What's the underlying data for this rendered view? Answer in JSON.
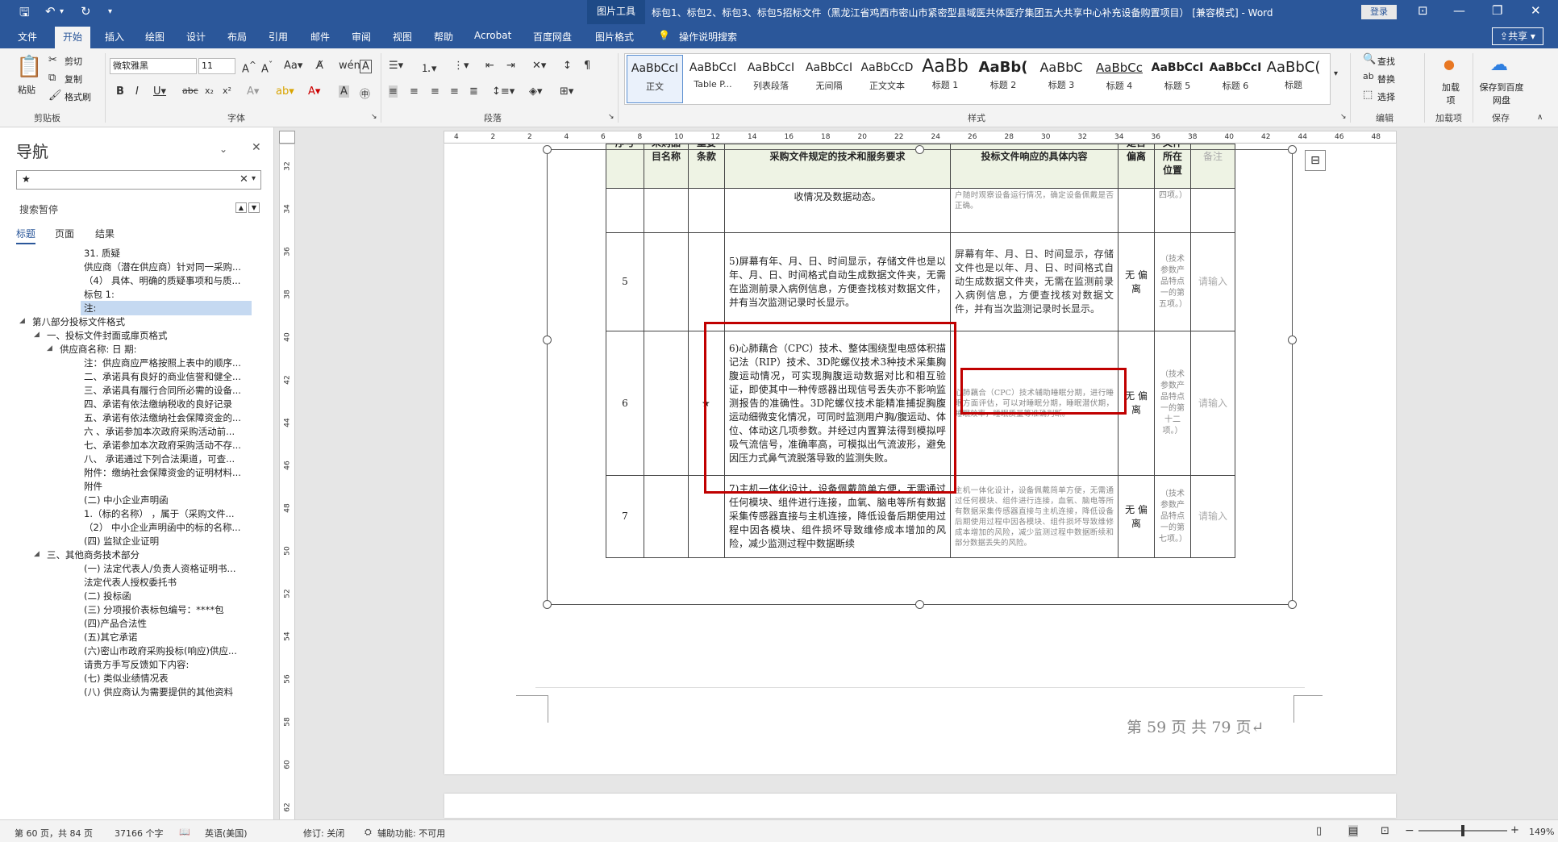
{
  "titlebar": {
    "context_tab": "图片工具",
    "doc_title": "标包1、标包2、标包3、标包5招标文件（黑龙江省鸡西市密山市紧密型县域医共体医疗集团五大共享中心补充设备购置项目） [兼容模式] - Word",
    "login": "登录"
  },
  "tabs": {
    "items": [
      "文件",
      "开始",
      "插入",
      "绘图",
      "设计",
      "布局",
      "引用",
      "邮件",
      "审阅",
      "视图",
      "帮助",
      "Acrobat",
      "百度网盘",
      "图片格式"
    ],
    "tell_me": "操作说明搜索",
    "share": "共享"
  },
  "ribbon": {
    "clipboard": {
      "paste": "粘贴",
      "cut": "剪切",
      "copy": "复制",
      "format_painter": "格式刷",
      "label": "剪贴板"
    },
    "font": {
      "name": "微软雅黑",
      "size": "11",
      "label": "字体"
    },
    "paragraph": {
      "label": "段落"
    },
    "styles": {
      "label": "样式",
      "items": [
        {
          "sample": "AaBbCcI",
          "name": "正文"
        },
        {
          "sample": "AaBbCcI",
          "name": "Table P..."
        },
        {
          "sample": "AaBbCcI",
          "name": "列表段落"
        },
        {
          "sample": "AaBbCcI",
          "name": "无间隔"
        },
        {
          "sample": "AaBbCcD",
          "name": "正文文本"
        },
        {
          "sample": "AaBb",
          "name": "标题 1"
        },
        {
          "sample": "AaBb(",
          "name": "标题 2"
        },
        {
          "sample": "AaBbC",
          "name": "标题 3"
        },
        {
          "sample": "AaBbCc",
          "name": "标题 4"
        },
        {
          "sample": "AaBbCcI",
          "name": "标题 5"
        },
        {
          "sample": "AaBbCcI",
          "name": "标题 6"
        },
        {
          "sample": "AaBbC(",
          "name": "标题"
        }
      ]
    },
    "editing": {
      "find": "查找",
      "replace": "替换",
      "select": "选择",
      "label": "编辑"
    },
    "addins": {
      "load": "加载项",
      "label": "加载项"
    },
    "save": {
      "baidu": "保存到百度网盘",
      "label": "保存"
    }
  },
  "nav": {
    "title": "导航",
    "search_value": "★",
    "search_status": "搜索暂停",
    "tabs": [
      "标题",
      "页面",
      "结果"
    ],
    "items": [
      {
        "text": "31. 质疑",
        "level": 3,
        "tri": ""
      },
      {
        "text": "供应商（潜在供应商）针对同一采购...",
        "level": 3,
        "tri": ""
      },
      {
        "text": "（4） 具体、明确的质疑事项和与质...",
        "level": 3,
        "tri": ""
      },
      {
        "text": "标包 1:",
        "level": 3,
        "tri": ""
      },
      {
        "text": "注:",
        "level": 3,
        "tri": "",
        "highlight": true
      },
      {
        "text": "第八部分投标文件格式",
        "level": 1,
        "tri": "◢"
      },
      {
        "text": "一、投标文件封面或扉页格式",
        "level": 2,
        "tri": "◢"
      },
      {
        "text": "供应商名称:                    日 期:",
        "level": 3,
        "tri": "◢",
        "indent": 60
      },
      {
        "text": "注：供应商应严格按照上表中的顺序...",
        "level": 3,
        "tri": ""
      },
      {
        "text": "二、承诺具有良好的商业信誉和健全...",
        "level": 3,
        "tri": ""
      },
      {
        "text": "三、承诺具有履行合同所必需的设备...",
        "level": 3,
        "tri": ""
      },
      {
        "text": "四、承诺有依法缴纳税收的良好记录",
        "level": 3,
        "tri": ""
      },
      {
        "text": "五、承诺有依法缴纳社会保障资金的...",
        "level": 3,
        "tri": ""
      },
      {
        "text": "六 、承诺参加本次政府采购活动前...",
        "level": 3,
        "tri": ""
      },
      {
        "text": "七、承诺参加本次政府采购活动不存...",
        "level": 3,
        "tri": ""
      },
      {
        "text": "八、 承诺通过下列合法渠道，可查...",
        "level": 3,
        "tri": ""
      },
      {
        "text": "附件：缴纳社会保障资金的证明材料...",
        "level": 3,
        "tri": ""
      },
      {
        "text": "附件",
        "level": 3,
        "tri": ""
      },
      {
        "text": "(二) 中小企业声明函",
        "level": 3,
        "tri": ""
      },
      {
        "text": "1.（标的名称）   ，属于（采购文件...",
        "level": 3,
        "tri": ""
      },
      {
        "text": "（2） 中小企业声明函中的标的名称...",
        "level": 3,
        "tri": ""
      },
      {
        "text": "(四) 监狱企业证明",
        "level": 3,
        "tri": ""
      },
      {
        "text": "三、其他商务技术部分",
        "level": 2,
        "tri": "◢"
      },
      {
        "text": "(一) 法定代表人/负责人资格证明书...",
        "level": 3,
        "tri": ""
      },
      {
        "text": "法定代表人授权委托书",
        "level": 3,
        "tri": ""
      },
      {
        "text": "(二) 投标函",
        "level": 3,
        "tri": ""
      },
      {
        "text": "(三) 分项报价表标包编号：****包",
        "level": 3,
        "tri": ""
      },
      {
        "text": "(四)产品合法性",
        "level": 3,
        "tri": ""
      },
      {
        "text": "(五)其它承诺",
        "level": 3,
        "tri": ""
      },
      {
        "text": "(六)密山市政府采购投标(响应)供应...",
        "level": 3,
        "tri": ""
      },
      {
        "text": "请贵方手写反馈如下内容:",
        "level": 3,
        "tri": ""
      },
      {
        "text": "(七) 类似业绩情况表",
        "level": 3,
        "tri": ""
      },
      {
        "text": "(八) 供应商认为需要提供的其他资料",
        "level": 3,
        "tri": ""
      }
    ]
  },
  "ruler": {
    "h_ticks": [
      "4",
      "2",
      "2",
      "4",
      "6",
      "8",
      "10",
      "12",
      "14",
      "16",
      "18",
      "20",
      "22",
      "24",
      "26",
      "28",
      "30",
      "32",
      "34",
      "36",
      "38",
      "40",
      "42",
      "44",
      "46",
      "48"
    ],
    "v_ticks": [
      "32",
      "34",
      "36",
      "38",
      "40",
      "42",
      "44",
      "46",
      "48",
      "50",
      "52",
      "54",
      "56",
      "58",
      "60",
      "62"
    ]
  },
  "table": {
    "headers": [
      "序号",
      "采购品目名称",
      "重要条款",
      "采购文件规定的技术和服务要求",
      "投标文件响应的具体内容",
      "是否偏离",
      "文件所在位置",
      "备注"
    ],
    "rows": [
      {
        "no": "",
        "req": "收情况及数据动态。",
        "resp": "户随时观察设备运行情况，确定设备佩戴是否正确。",
        "dev": "",
        "loc": "四项。）",
        "note": "",
        "small": true
      },
      {
        "no": "5",
        "req": "5)屏幕有年、月、日、时间显示，存储文件也是以年、月、日、时间格式自动生成数据文件夹，无需在监测前录入病例信息，方便查找核对数据文件，并有当次监测记录时长显示。",
        "resp": "屏幕有年、月、日、时间显示，存储文件也是以年、月、日、时间格式自动生成数据文件夹，无需在监测前录入病例信息，方便查找核对数据文件，并有当次监测记录时长显示。",
        "dev": "无 偏离",
        "loc": "（技术参数产品特点一的第五项。）",
        "note": "请输入",
        "small": false
      },
      {
        "no": "6",
        "req": "6)心肺藕合（CPC）技术、整体围绕型电感体积描记法（RIP）技术、3D陀螺仪技术3种技术采集胸腹运动情况，可实现胸腹运动数据对比和相互验证，即使其中一种传感器出现信号丢失亦不影响监测报告的准确性。3D陀螺仪技术能精准捕捉胸腹运动细微变化情况，可同时监测用户胸/腹运动、体位、体动这几项参数。并经过内置算法得到模拟呼吸气流信号，准确率高，可模拟出气流波形，避免因压力式鼻气流脱落导致的监测失败。",
        "resp": "心肺藕合（CPC）技术辅助睡眠分期，进行睡眠方面评估，可以对睡眠分期，睡眠潜伏期，睡眠效率，睡眠质量等准确判断。",
        "dev": "无 偏离",
        "loc": "（技术参数产品特点一的第十二项。）",
        "note": "请输入",
        "small": true,
        "star": "★"
      },
      {
        "no": "7",
        "req": "7)主机一体化设计，设备佩戴简单方便，无需通过任何模块、组件进行连接，血氧、脑电等所有数据采集传感器直接与主机连接，降低设备后期使用过程中因各模块、组件损坏导致维修成本增加的风险，减少监测过程中数据断续",
        "resp": "主机一体化设计，设备佩戴简单方便，无需通过任何模块、组件进行连接，血氧、脑电等所有数据采集传感器直接与主机连接，降低设备后期使用过程中因各模块、组件损坏导致维修成本增加的风险，减少监测过程中数据断续和部分数据丢失的风险。",
        "dev": "无 偏离",
        "loc": "（技术参数产品特点一的第七项。）",
        "note": "请输入",
        "small": true
      }
    ]
  },
  "footer": {
    "page_text": "第 59 页 共 79 页↵"
  },
  "status": {
    "page": "第 60 页，共 84 页",
    "words": "37166 个字",
    "lang": "英语(美国)",
    "track": "修订: 关闭",
    "access": "辅助功能: 不可用",
    "zoom": "149%"
  }
}
